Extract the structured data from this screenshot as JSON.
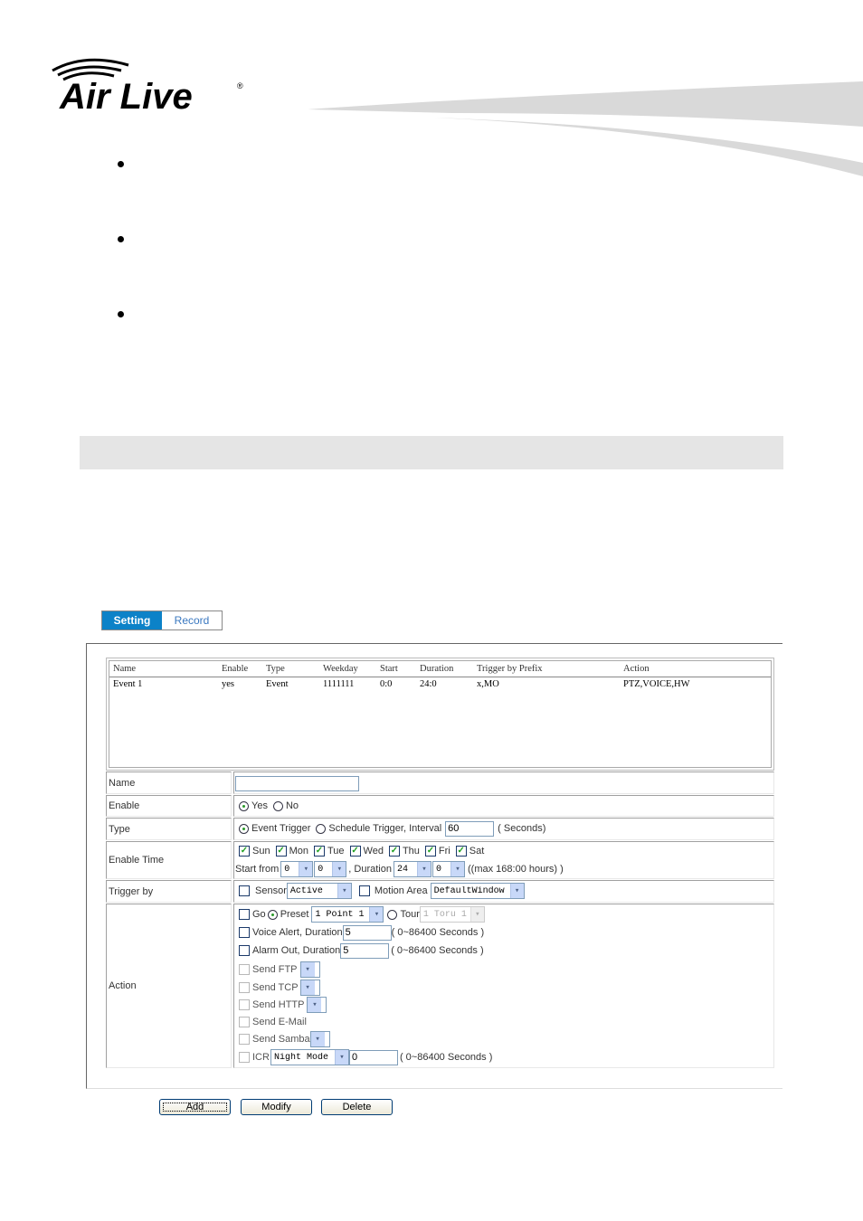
{
  "brand": {
    "name": "Air Live",
    "registered_mark": "®"
  },
  "tabs": [
    {
      "label": "Setting",
      "active": true
    },
    {
      "label": "Record",
      "active": false
    }
  ],
  "event_list": {
    "columns": [
      "Name",
      "Enable",
      "Type",
      "Weekday",
      "Start",
      "Duration",
      "Trigger by Prefix",
      "Action"
    ],
    "rows": [
      {
        "name": "Event 1",
        "enable": "yes",
        "type": "Event",
        "weekday": "1111111",
        "start": "0:0",
        "duration": "24:0",
        "trigger": "x,MO",
        "action": "PTZ,VOICE,HW"
      }
    ]
  },
  "form": {
    "name": {
      "label": "Name",
      "value": ""
    },
    "enable": {
      "label": "Enable",
      "options": [
        "Yes",
        "No"
      ],
      "selected": "Yes"
    },
    "type": {
      "label": "Type",
      "event_trigger": "Event Trigger",
      "schedule_trigger": "Schedule Trigger, Interval",
      "selected": "Event Trigger",
      "interval": "60",
      "unit": "( Seconds)"
    },
    "enable_time": {
      "label": "Enable Time",
      "days": [
        {
          "label": "Sun",
          "checked": true
        },
        {
          "label": "Mon",
          "checked": true
        },
        {
          "label": "Tue",
          "checked": true
        },
        {
          "label": "Wed",
          "checked": true
        },
        {
          "label": "Thu",
          "checked": true
        },
        {
          "label": "Fri",
          "checked": true
        },
        {
          "label": "Sat",
          "checked": true
        }
      ],
      "start_from_label": "Start from",
      "start_hour": "0",
      "start_min": "0",
      "duration_label": ", Duration",
      "duration_hour": "24",
      "duration_min": "0",
      "max_note": "((max 168:00 hours) )"
    },
    "trigger_by": {
      "label": "Trigger by",
      "sensor_label": "Sensor",
      "sensor_checked": false,
      "sensor_value": "Active",
      "motion_label": "Motion Area",
      "motion_checked": false,
      "motion_value": "DefaultWindow"
    },
    "action": {
      "label": "Action",
      "go_label": "Go",
      "preset_label": "Preset",
      "preset_value": "1 Point 1",
      "tour_label": "Tour",
      "tour_value": "1 Toru 1",
      "voice_label": "Voice Alert, Duration",
      "voice_value": "5",
      "alarm_label": "Alarm Out, Duration",
      "alarm_value": "5",
      "range_note": "( 0~86400 Seconds )",
      "send_ftp": "Send FTP",
      "send_tcp": "Send TCP",
      "send_http": "Send HTTP",
      "send_email": "Send E-Mail",
      "send_samba": "Send Samba",
      "icr_label": "ICR",
      "icr_mode": "Night Mode",
      "icr_value": "0"
    }
  },
  "buttons": {
    "add": "Add",
    "modify": "Modify",
    "delete": "Delete"
  }
}
